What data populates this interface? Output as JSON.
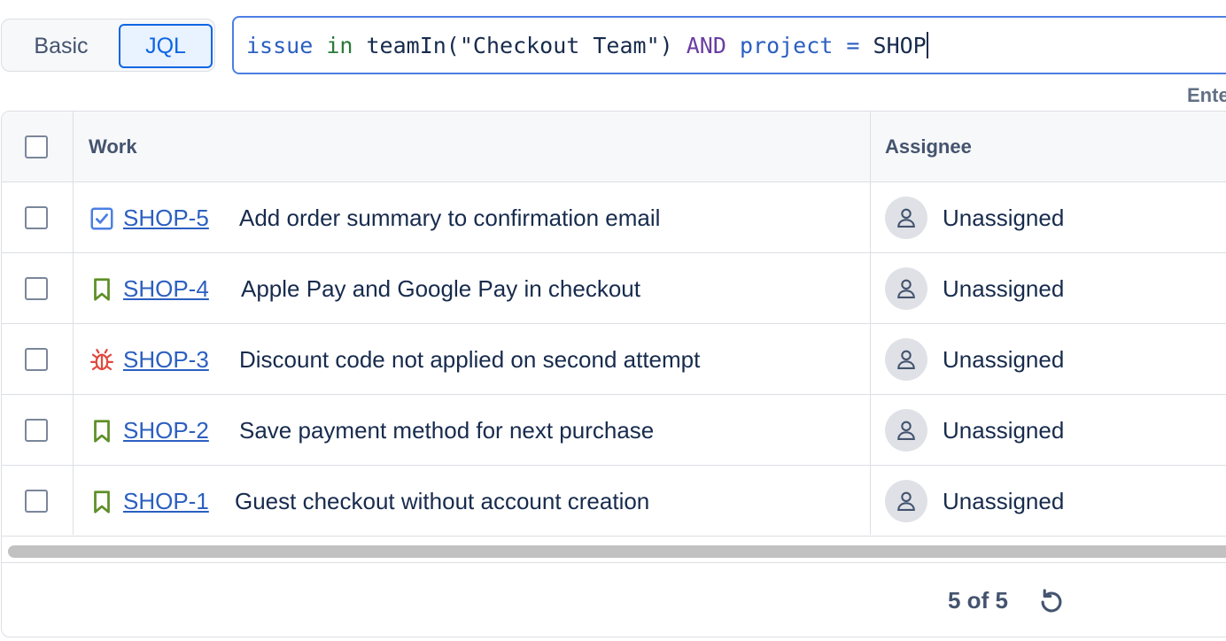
{
  "search": {
    "mode_basic": "Basic",
    "mode_jql": "JQL",
    "query_tokens": [
      {
        "text": "issue",
        "kind": "kw"
      },
      {
        "text": " ",
        "kind": "sp"
      },
      {
        "text": "in",
        "kind": "op"
      },
      {
        "text": " ",
        "kind": "sp"
      },
      {
        "text": "teamIn(\"Checkout Team\")",
        "kind": "fn"
      },
      {
        "text": " ",
        "kind": "sp"
      },
      {
        "text": "AND",
        "kind": "and"
      },
      {
        "text": " ",
        "kind": "sp"
      },
      {
        "text": "project",
        "kind": "field"
      },
      {
        "text": " ",
        "kind": "sp"
      },
      {
        "text": "=",
        "kind": "eq"
      },
      {
        "text": " ",
        "kind": "sp"
      },
      {
        "text": "SHOP",
        "kind": "val"
      }
    ],
    "hint": "Ente"
  },
  "table": {
    "columns": {
      "work": "Work",
      "assignee": "Assignee"
    },
    "rows": [
      {
        "type": "task-icon",
        "key": "SHOP-5",
        "summary": "Add order summary to confirmation email",
        "assignee": "Unassigned"
      },
      {
        "type": "story-icon",
        "key": "SHOP-4",
        "summary": "Apple Pay and Google Pay in checkout",
        "assignee": "Unassigned"
      },
      {
        "type": "bug-icon",
        "key": "SHOP-3",
        "summary": "Discount code not applied on second attempt",
        "assignee": "Unassigned"
      },
      {
        "type": "story-icon",
        "key": "SHOP-2",
        "summary": "Save payment method for next purchase",
        "assignee": "Unassigned"
      },
      {
        "type": "story-icon",
        "key": "SHOP-1",
        "summary": "Guest checkout without account creation",
        "assignee": "Unassigned"
      }
    ]
  },
  "footer": {
    "count": "5 of 5"
  },
  "colors": {
    "task": "#4c7fe3",
    "story": "#5e8f28",
    "bug": "#e2483d",
    "link": "#2b5fc1"
  }
}
